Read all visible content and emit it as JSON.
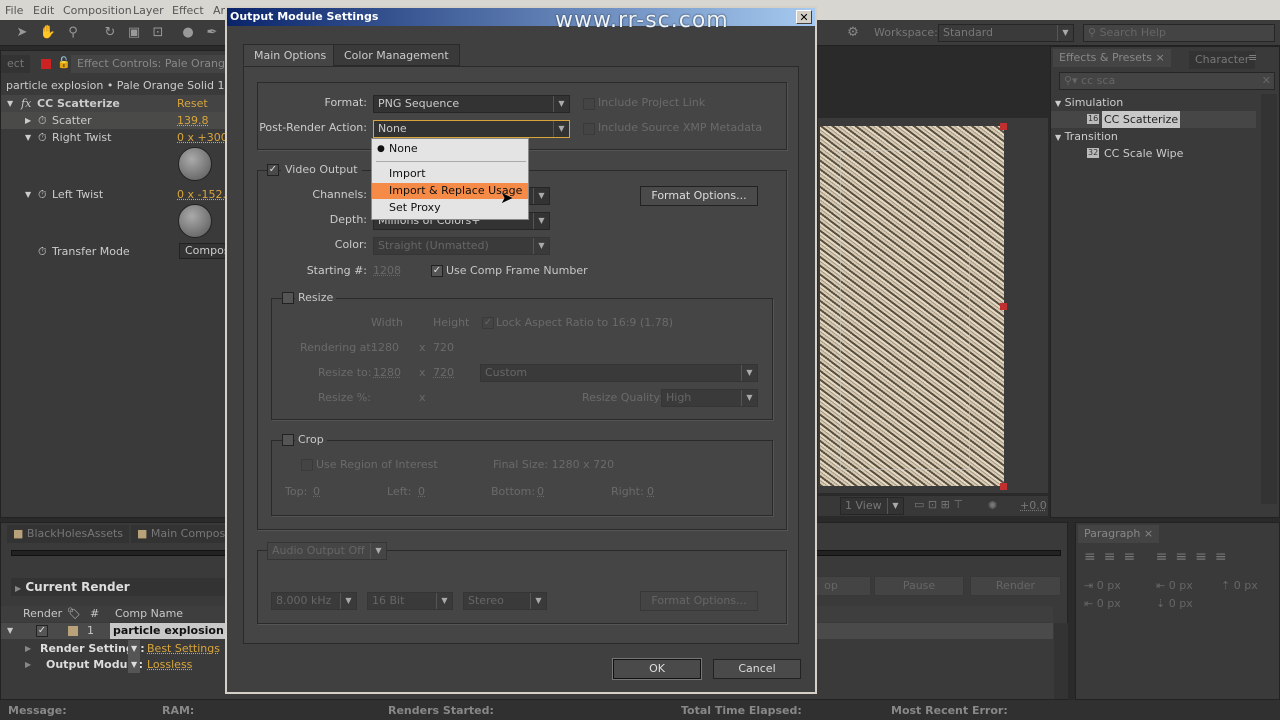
{
  "menubar": {
    "items": [
      "File",
      "Edit",
      "Composition",
      "Layer",
      "Effect",
      "An"
    ]
  },
  "workspace": {
    "label": "Workspace:",
    "value": "Standard",
    "search_placeholder": "Search Help"
  },
  "effect_controls": {
    "tab_partial": "ect",
    "tab_title": "Effect Controls: Pale Orange S",
    "breadcrumb": "particle explosion • Pale Orange Solid 1",
    "effect_name": "CC Scatterize",
    "reset_label": "Reset",
    "params": [
      {
        "name": "Scatter",
        "value": "139.8"
      },
      {
        "name": "Right Twist",
        "value": "0 x +300."
      },
      {
        "name": "Left Twist",
        "value": "0 x -152."
      },
      {
        "name": "Transfer Mode",
        "value": "Composi"
      }
    ]
  },
  "effects_presets": {
    "tab": "Effects & Presets",
    "tab2": "Character",
    "search_value": "cc sca",
    "tree": [
      {
        "category": "Simulation",
        "item": "CC Scatterize",
        "badge": "16"
      },
      {
        "category": "Transition",
        "item": "CC Scale Wipe",
        "badge": "32"
      }
    ]
  },
  "viewer": {
    "views": "1 View",
    "exposure": "+0.0"
  },
  "render_queue": {
    "tabs": [
      "BlackHolesAssets",
      "Main Compositi"
    ],
    "current_render": "Current Render",
    "columns": [
      "Render",
      "#",
      "Comp Name"
    ],
    "item": {
      "number": "1",
      "comp_name": "particle explosion",
      "render_settings_label": "Render Settings:",
      "render_settings": "Best Settings",
      "output_module_label": "Output Module:",
      "output_module": "Lossless"
    },
    "buttons": [
      "op",
      "Pause",
      "Render"
    ]
  },
  "paragraph": {
    "tab": "Paragraph",
    "values": [
      "0 px",
      "0 px",
      "0 px",
      "0 px",
      "0 px"
    ]
  },
  "status_bar": {
    "message": "Message:",
    "ram": "RAM:",
    "renders_started": "Renders Started:",
    "total_time": "Total Time Elapsed:",
    "recent_error": "Most Recent Error:"
  },
  "dialog": {
    "title": "Output Module Settings",
    "close": "✕",
    "tabs": [
      "Main Options",
      "Color Management"
    ],
    "format_label": "Format:",
    "format": "PNG Sequence",
    "post_render_label": "Post-Render Action:",
    "post_render": "None",
    "include_project_link": "Include Project Link",
    "include_xmp": "Include Source XMP Metadata",
    "dropdown_options": [
      "None",
      "Import",
      "Import & Replace Usage",
      "Set Proxy"
    ],
    "dropdown_highlighted": "Import & Replace Usage",
    "video_output": "Video Output",
    "channels_label": "Channels:",
    "depth_label": "Depth:",
    "depth": "Millions of Colors+",
    "color_label": "Color:",
    "color": "Straight (Unmatted)",
    "format_options": "Format Options...",
    "starting_label": "Starting #:",
    "starting": "1208",
    "use_comp_frame": "Use Comp Frame Number",
    "resize": {
      "label": "Resize",
      "width": "Width",
      "height": "Height",
      "lock": "Lock Aspect Ratio to 16:9 (1.78)",
      "rendering_at_label": "Rendering at:",
      "rendering_w": "1280",
      "rendering_h": "720",
      "resize_to_label": "Resize to:",
      "resize_w": "1280",
      "resize_h": "720",
      "preset": "Custom",
      "resize_pct_label": "Resize %:",
      "x": "x",
      "quality_label": "Resize Quality:",
      "quality": "High"
    },
    "crop": {
      "label": "Crop",
      "use_roi": "Use Region of Interest",
      "final_size": "Final Size: 1280 x 720",
      "top_label": "Top:",
      "top": "0",
      "left_label": "Left:",
      "left": "0",
      "bottom_label": "Bottom:",
      "bottom": "0",
      "right_label": "Right:",
      "right": "0"
    },
    "audio": {
      "output": "Audio Output Off",
      "rate": "8.000 kHz",
      "bits": "16 Bit",
      "channels": "Stereo",
      "format_options": "Format Options..."
    },
    "ok": "OK",
    "cancel": "Cancel"
  },
  "watermark": "www.rr-sc.com",
  "colors": {
    "highlight": "#f68b48",
    "title_bar": "#0a246a",
    "accent_value": "#d9a53a"
  }
}
